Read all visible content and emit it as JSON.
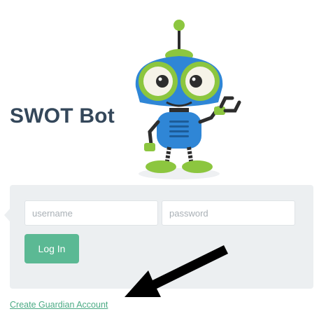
{
  "app": {
    "title": "SWOT Bot"
  },
  "mascot": {
    "icon": "robot-mascot-icon",
    "colors": {
      "body": "#2f86d6",
      "accent": "#8cc63f",
      "dark": "#2d2d2d"
    }
  },
  "login": {
    "username_placeholder": "username",
    "username_value": "",
    "password_placeholder": "password",
    "password_value": "",
    "button_label": "Log In"
  },
  "links": {
    "create_guardian": "Create Guardian Account"
  },
  "colors": {
    "title": "#34475a",
    "button": "#5bb994",
    "link": "#4cab85",
    "panel": "#eceff1"
  },
  "annotation": {
    "icon": "pointer-arrow-icon"
  }
}
